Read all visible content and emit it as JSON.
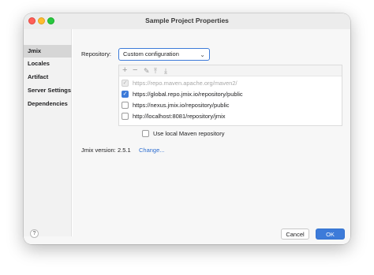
{
  "window": {
    "title": "Sample Project Properties"
  },
  "sidebar": {
    "items": [
      {
        "label": "Jmix",
        "active": true
      },
      {
        "label": "Locales",
        "active": false
      },
      {
        "label": "Artifact",
        "active": false
      },
      {
        "label": "Server Settings",
        "active": false
      },
      {
        "label": "Dependencies",
        "active": false
      }
    ]
  },
  "repository": {
    "label": "Repository:",
    "selected": "Custom configuration",
    "toolbar_icons": [
      "add-icon",
      "remove-icon",
      "edit-icon",
      "move-up-icon",
      "move-down-icon"
    ],
    "items": [
      {
        "url": "https://repo.maven.apache.org/maven2/",
        "checked": true,
        "disabled": true
      },
      {
        "url": "https://global.repo.jmix.io/repository/public",
        "checked": true,
        "disabled": false
      },
      {
        "url": "https://nexus.jmix.io/repository/public",
        "checked": false,
        "disabled": false
      },
      {
        "url": "http://localhost:8081/repository/jmix",
        "checked": false,
        "disabled": false
      }
    ]
  },
  "local_maven": {
    "label": "Use local Maven repository",
    "checked": false
  },
  "version": {
    "label": "Jmix version:",
    "value": "2.5.1",
    "change_link": "Change..."
  },
  "footer": {
    "help": "?",
    "cancel": "Cancel",
    "ok": "OK"
  },
  "colors": {
    "accent": "#3d7bd9",
    "link": "#2f6fd0"
  }
}
